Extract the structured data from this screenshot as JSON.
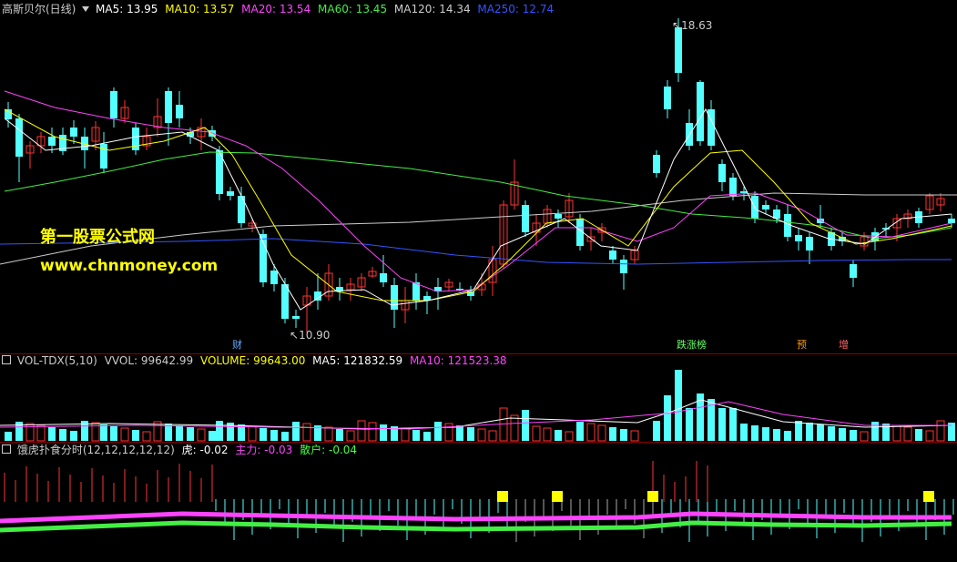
{
  "main": {
    "title": "高斯贝尔(日线)",
    "ma": [
      {
        "label": "MA5: 13.95",
        "color": "#ffffff"
      },
      {
        "label": "MA10: 13.57",
        "color": "#ffff00"
      },
      {
        "label": "MA20: 13.54",
        "color": "#ff44ff"
      },
      {
        "label": "MA60: 13.45",
        "color": "#44ee44"
      },
      {
        "label": "MA120: 14.34",
        "color": "#cccccc"
      },
      {
        "label": "MA250: 12.74",
        "color": "#3355ff"
      }
    ],
    "high_label": "18.63",
    "low_label": "10.90",
    "watermark_line1": "第一股票公式网",
    "watermark_line2": "www.chnmoney.com",
    "events": [
      {
        "text": "财",
        "color": "#66aaff"
      },
      {
        "text": "跌涨榜",
        "color": "#66ff66"
      },
      {
        "text": "预",
        "color": "#ff9900"
      },
      {
        "text": "增",
        "color": "#ff6666"
      }
    ]
  },
  "volume": {
    "title": "VOL-TDX(5,10)",
    "items": [
      {
        "label": "VVOL: 99642.99",
        "color": "#cccccc"
      },
      {
        "label": "VOLUME: 99643.00",
        "color": "#ffff00"
      },
      {
        "label": "MA5: 121832.59",
        "color": "#ffffff"
      },
      {
        "label": "MA10: 121523.38",
        "color": "#ff44ff"
      }
    ]
  },
  "indicator": {
    "title": "饿虎扑食分时(12,12,12,12,12)",
    "items": [
      {
        "label": "虎: -0.02",
        "color": "#ffffff"
      },
      {
        "label": "主力: -0.03",
        "color": "#ff44ff"
      },
      {
        "label": "散户: -0.04",
        "color": "#44ff44"
      }
    ]
  },
  "colors": {
    "up": "#ff3333",
    "down": "#54ffff",
    "ma5": "#ffffff",
    "ma10": "#ffff00",
    "ma20": "#ff44ff",
    "ma60": "#44ee44",
    "ma120": "#cccccc",
    "ma250": "#3355ff"
  }
}
